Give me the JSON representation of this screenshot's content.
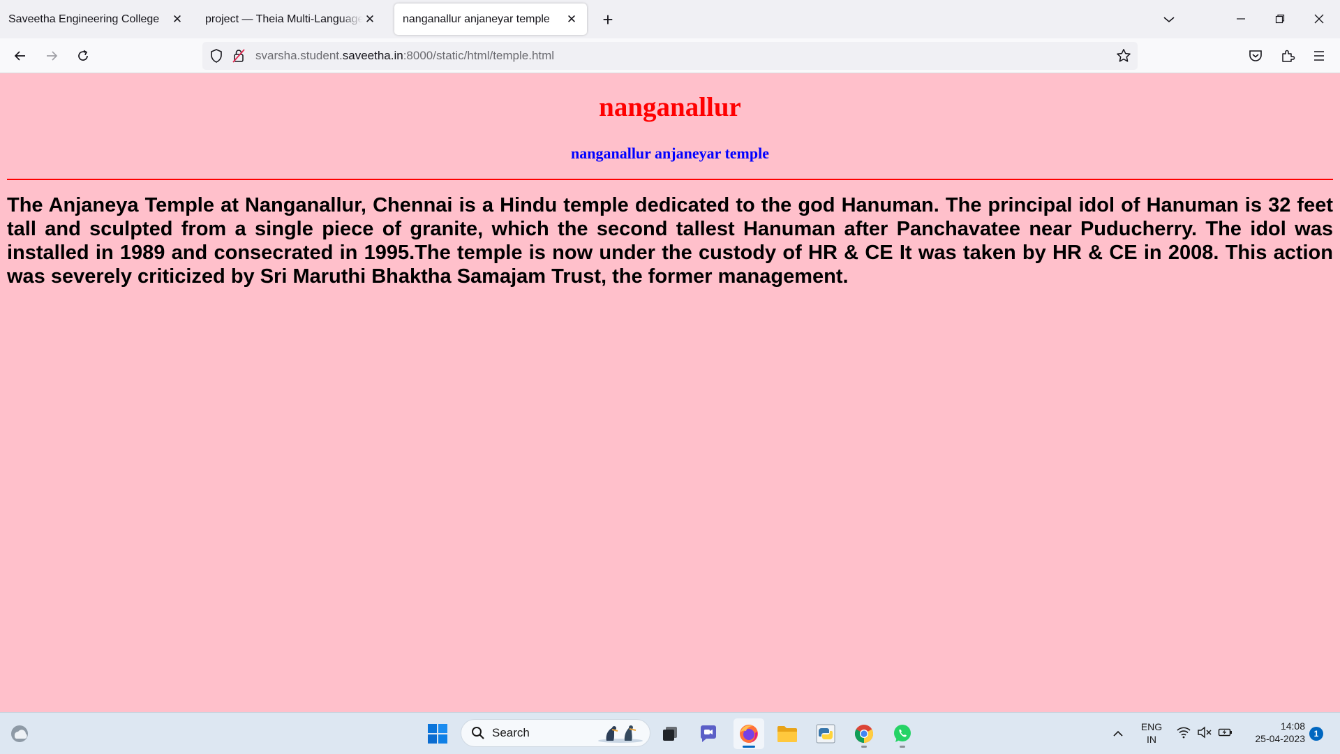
{
  "browser": {
    "tabs": [
      {
        "title": "Saveetha Engineering College",
        "active": false
      },
      {
        "title": "project — Theia Multi-Language Explorer",
        "active": false
      },
      {
        "title": "nanganallur anjaneyar temple",
        "active": true
      }
    ],
    "url": {
      "prefix": "svarsha.student.",
      "domain": "saveetha.in",
      "suffix": ":8000/static/html/temple.html"
    }
  },
  "page": {
    "heading": "nanganallur",
    "subheading": "nanganallur anjaneyar temple",
    "paragraph": "The Anjaneya Temple at Nanganallur, Chennai is a Hindu temple dedicated to the god Hanuman. The principal idol of Hanuman is 32 feet tall and sculpted from a single piece of granite, which the second tallest Hanuman after Panchavatee near Puducherry. The idol was installed in 1989 and consecrated in 1995.The temple is now under the custody of HR & CE It was taken by HR & CE in 2008. This action was severely criticized by Sri Maruthi Bhaktha Samajam Trust, the former management.",
    "colors": {
      "background": "#ffc0cb",
      "heading": "#ff0000",
      "subheading": "#0000ff",
      "rule": "#ff0000"
    }
  },
  "taskbar": {
    "search_label": "Search",
    "language": {
      "line1": "ENG",
      "line2": "IN"
    },
    "clock": {
      "time": "14:08",
      "date": "25-04-2023"
    },
    "notification_count": "1",
    "apps": [
      "weather-icon",
      "windows-start-icon",
      "task-view-icon",
      "teams-chat-icon",
      "firefox-icon",
      "file-explorer-icon",
      "python-idle-icon",
      "chrome-icon",
      "whatsapp-icon"
    ]
  }
}
